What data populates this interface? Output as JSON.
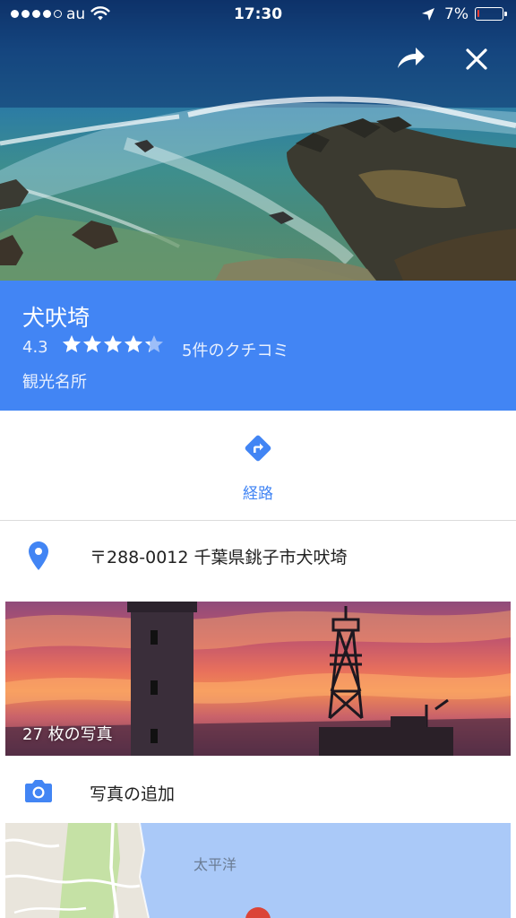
{
  "status_bar": {
    "carrier": "au",
    "time": "17:30",
    "battery_percent": "7%",
    "battery_level": 0.07,
    "signal_bars_filled": 4,
    "signal_bars_total": 5
  },
  "header": {
    "share_icon": "share-arrow-icon",
    "close_icon": "close-x-icon"
  },
  "place": {
    "name": "犬吠埼",
    "rating": "4.3",
    "rating_value": 4.3,
    "rating_max": 5,
    "reviews": "5件のクチコミ",
    "category": "観光名所"
  },
  "directions": {
    "label": "経路",
    "icon": "directions-diamond-icon"
  },
  "address": {
    "text": "〒288-0012 千葉県銚子市犬吠埼",
    "icon": "location-pin-icon"
  },
  "photos": {
    "count_label": "27 枚の写真"
  },
  "add_photo": {
    "label": "写真の追加",
    "icon": "camera-icon"
  },
  "map": {
    "ocean_label": "太平洋"
  },
  "colors": {
    "accent": "#4285f4",
    "battery_low": "#ff3b30",
    "text_primary": "#212121"
  }
}
